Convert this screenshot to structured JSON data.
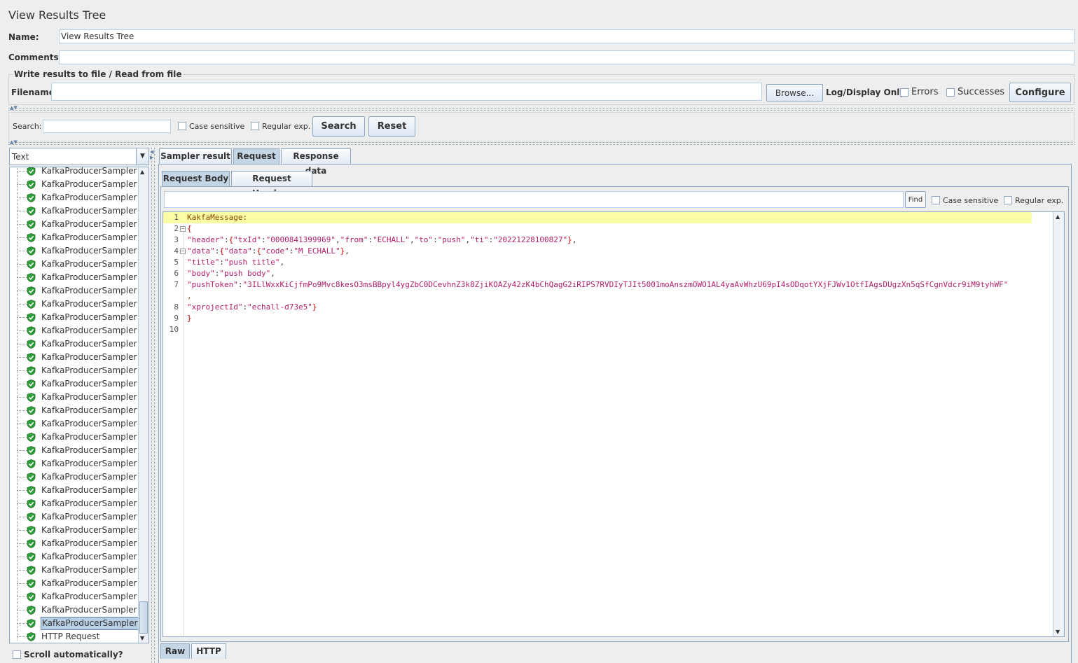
{
  "window": {
    "title": "View Results Tree"
  },
  "form": {
    "name_label": "Name:",
    "name_value": "View Results Tree",
    "comments_label": "Comments:",
    "comments_value": ""
  },
  "file_section": {
    "legend": "Write results to file / Read from file",
    "filename_label": "Filename",
    "filename_value": "",
    "browse_label": "Browse...",
    "log_display_label": "Log/Display Only:",
    "errors_label": "Errors",
    "successes_label": "Successes",
    "configure_label": "Configure"
  },
  "search_bar": {
    "label": "Search:",
    "value": "",
    "case_sensitive_label": "Case sensitive",
    "regex_label": "Regular exp.",
    "search_label": "Search",
    "reset_label": "Reset"
  },
  "tree": {
    "renderer_selected": "Text",
    "items": [
      "KafkaProducerSampler",
      "KafkaProducerSampler",
      "KafkaProducerSampler",
      "KafkaProducerSampler",
      "KafkaProducerSampler",
      "KafkaProducerSampler",
      "KafkaProducerSampler",
      "KafkaProducerSampler",
      "KafkaProducerSampler",
      "KafkaProducerSampler",
      "KafkaProducerSampler",
      "KafkaProducerSampler",
      "KafkaProducerSampler",
      "KafkaProducerSampler",
      "KafkaProducerSampler",
      "KafkaProducerSampler",
      "KafkaProducerSampler",
      "KafkaProducerSampler",
      "KafkaProducerSampler",
      "KafkaProducerSampler",
      "KafkaProducerSampler",
      "KafkaProducerSampler",
      "KafkaProducerSampler",
      "KafkaProducerSampler",
      "KafkaProducerSampler",
      "KafkaProducerSampler",
      "KafkaProducerSampler",
      "KafkaProducerSampler",
      "KafkaProducerSampler",
      "KafkaProducerSampler",
      "KafkaProducerSampler",
      "KafkaProducerSampler",
      "KafkaProducerSampler",
      "KafkaProducerSampler",
      "KafkaProducerSampler",
      "HTTP Request"
    ],
    "selected_index": 34,
    "scroll_auto_label": "Scroll automatically?",
    "status_icon": "check-shield-icon"
  },
  "result_tabs": {
    "items": [
      "Sampler result",
      "Request",
      "Response data"
    ],
    "active_index": 1
  },
  "request_tabs": {
    "items": [
      "Request Body",
      "Request Headers"
    ],
    "active_index": 0
  },
  "find_bar": {
    "value": "",
    "find_label": "Find",
    "case_sensitive_label": "Case sensitive",
    "regex_label": "Regular exp."
  },
  "editor": {
    "lines": [
      {
        "num": "1",
        "text": "KakfaMessage:"
      },
      {
        "num": "2",
        "text": "{"
      },
      {
        "num": "3",
        "text": "\"header\":{\"txId\":\"0000841399969\",\"from\":\"ECHALL\",\"to\":\"push\",\"ti\":\"20221228100827\"},"
      },
      {
        "num": "4",
        "text": "\"data\":{\"data\":{\"code\":\"M_ECHALL\"},"
      },
      {
        "num": "5",
        "text": "\"title\":\"push title\","
      },
      {
        "num": "6",
        "text": "\"body\":\"push body\","
      },
      {
        "num": "7",
        "text": "\"pushToken\":\"3ILlWxxKiCjfmPo9Mvc8kesO3msBBpyl4ygZbC0DCevhnZ3k8ZjiKOAZy42zK4bChQagG2iRIPS7RVDIyTJIt5001moAnszmOWO1AL4yaAvWhzU69pI4sODqotYXjFJWv1OtfIAgsDUgzXn5qSfCgnVdcr9iM9tyhWF\""
      },
      {
        "num": "",
        "text": ","
      },
      {
        "num": "8",
        "text": "\"xprojectId\":\"echall-d73e5\"}"
      },
      {
        "num": "9",
        "text": "}"
      },
      {
        "num": "10",
        "text": ""
      }
    ]
  },
  "bottom_tabs": {
    "items": [
      "Raw",
      "HTTP"
    ],
    "active_index": 0
  }
}
